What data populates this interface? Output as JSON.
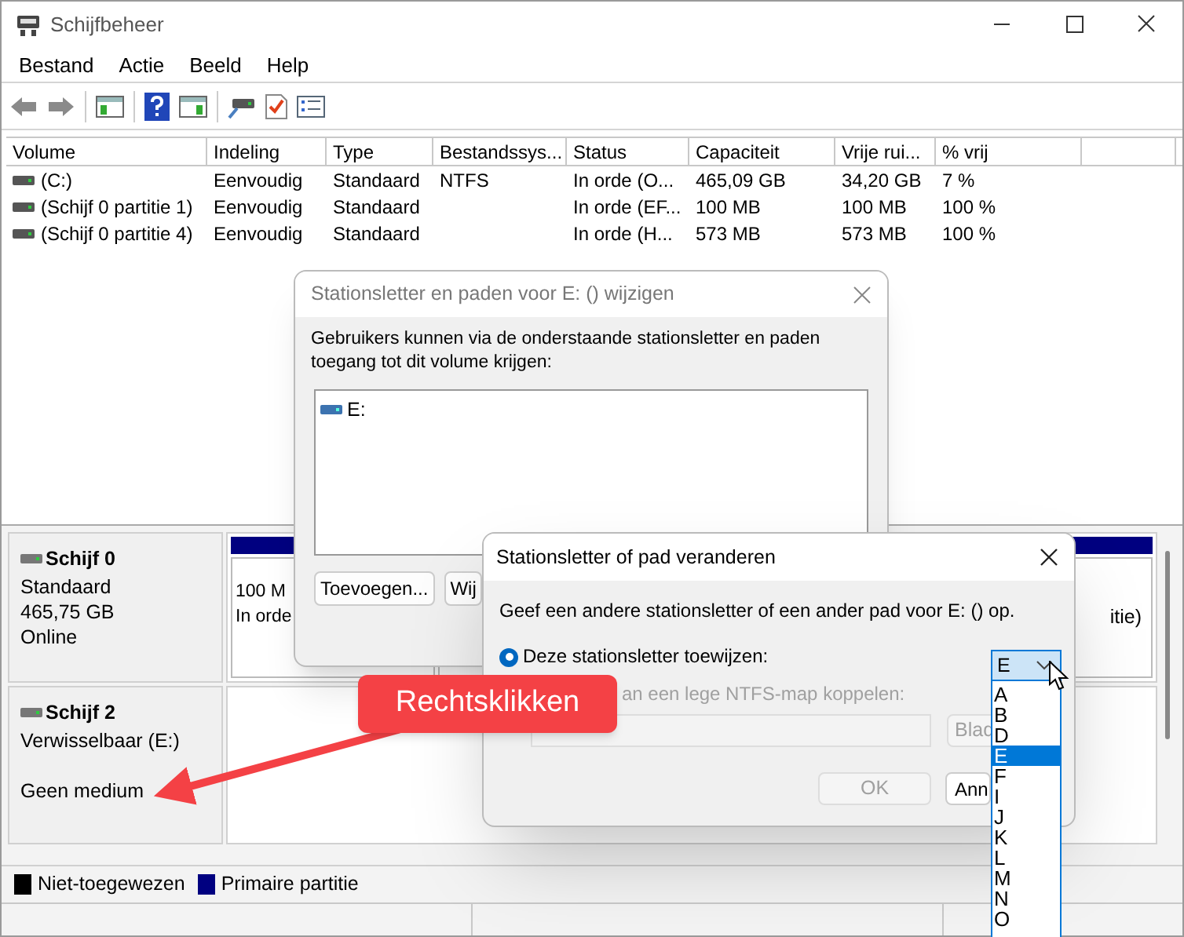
{
  "window": {
    "title": "Schijfbeheer"
  },
  "menu": [
    "Bestand",
    "Actie",
    "Beeld",
    "Help"
  ],
  "volume_table": {
    "columns": [
      "Volume",
      "Indeling",
      "Type",
      "Bestandssys...",
      "Status",
      "Capaciteit",
      "Vrije rui...",
      "% vrij"
    ],
    "rows": [
      {
        "cells": [
          "(C:)",
          "Eenvoudig",
          "Standaard",
          "NTFS",
          "In orde (O...",
          "465,09 GB",
          "34,20 GB",
          "7 %"
        ]
      },
      {
        "cells": [
          "(Schijf 0 partitie 1)",
          "Eenvoudig",
          "Standaard",
          "",
          "In orde (EF...",
          "100 MB",
          "100 MB",
          "100 %"
        ]
      },
      {
        "cells": [
          "(Schijf 0 partitie 4)",
          "Eenvoudig",
          "Standaard",
          "",
          "In orde (H...",
          "573 MB",
          "573 MB",
          "100 %"
        ]
      }
    ]
  },
  "disks": [
    {
      "name": "Schijf 0",
      "type": "Standaard",
      "size": "465,75 GB",
      "status": "Online",
      "partition_left": [
        "100 M",
        "In orde"
      ],
      "partition_right": "itie)"
    },
    {
      "name": "Schijf 2",
      "type": "Verwisselbaar (E:)",
      "status": "Geen medium"
    }
  ],
  "legend": [
    {
      "label": "Niet-toegewezen",
      "color": "#000000"
    },
    {
      "label": "Primaire partitie",
      "color": "#000080"
    }
  ],
  "paths_dialog": {
    "title": "Stationsletter en paden voor E: () wijzigen",
    "description": "Gebruikers kunnen via de onderstaande stationsletter en paden toegang tot dit volume krijgen:",
    "entries": [
      "E:"
    ],
    "buttons": [
      "Toevoegen...",
      "Wij"
    ]
  },
  "change_dialog": {
    "title": "Stationsletter of pad veranderen",
    "description": "Geef een andere stationsletter of een ander pad voor E: () op.",
    "assign_option": {
      "label": "Deze stationsletter toewijzen:",
      "selected": true
    },
    "mount_option": {
      "label": "an een lege NTFS-map koppelen:",
      "disabled": true
    },
    "letter_select": {
      "value": "E",
      "expanded": true,
      "options": [
        {
          "label": "A",
          "selected": false
        },
        {
          "label": "B",
          "selected": false
        },
        {
          "label": "D",
          "selected": false
        },
        {
          "label": "E",
          "selected": true
        },
        {
          "label": "F",
          "selected": false
        },
        {
          "label": "I",
          "selected": false
        },
        {
          "label": "J",
          "selected": false
        },
        {
          "label": "K",
          "selected": false
        },
        {
          "label": "L",
          "selected": false
        },
        {
          "label": "M",
          "selected": false
        },
        {
          "label": "N",
          "selected": false
        },
        {
          "label": "O",
          "selected": false
        }
      ]
    },
    "browse_button": {
      "label": "Blad",
      "disabled": true
    },
    "ok_button": {
      "label": "OK",
      "disabled": true
    },
    "cancel_button": "Ann"
  },
  "callout": {
    "text": "Rechtsklikken"
  }
}
